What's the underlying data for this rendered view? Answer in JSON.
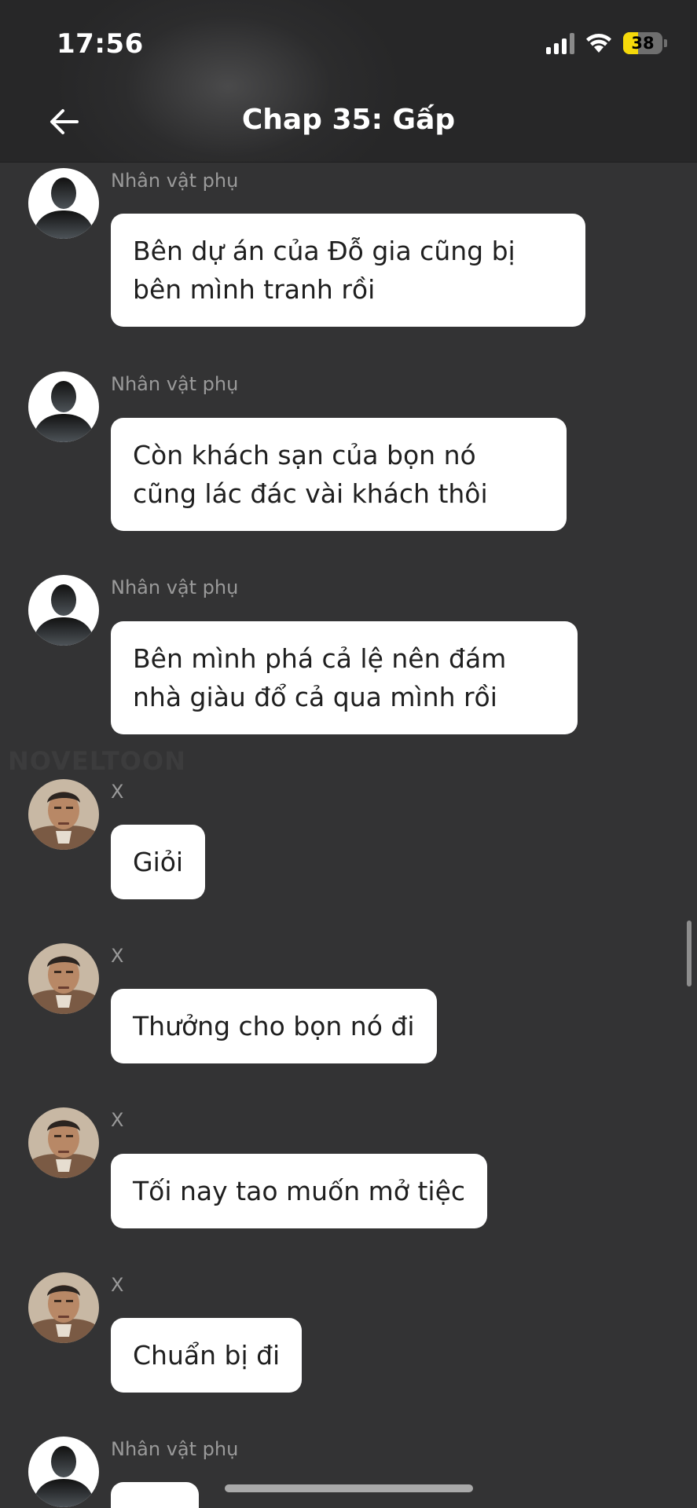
{
  "status_bar": {
    "time": "17:56",
    "battery": "38",
    "battery_level": 0.38
  },
  "header": {
    "back_icon": "arrow-left-icon",
    "title": "Chap 35: Gấp"
  },
  "watermark": "NOVELTOON",
  "messages": [
    {
      "sender": "Nhân vật phụ",
      "avatar": "silhouette-avatar",
      "text": "Bên dự án của Đỗ gia cũng bị bên mình tranh rồi"
    },
    {
      "sender": "Nhân vật phụ",
      "avatar": "silhouette-avatar",
      "text": "Còn khách sạn của bọn nó cũng lác đác vài khách thôi"
    },
    {
      "sender": "Nhân vật phụ",
      "avatar": "silhouette-avatar",
      "text": "Bên mình phá cả lệ nên đám nhà giàu đổ cả qua mình rồi"
    },
    {
      "sender": "X",
      "avatar": "character-x-avatar",
      "text": "Giỏi"
    },
    {
      "sender": "X",
      "avatar": "character-x-avatar",
      "text": "Thưởng cho bọn nó đi"
    },
    {
      "sender": "X",
      "avatar": "character-x-avatar",
      "text": "Tối nay tao muốn mở tiệc"
    },
    {
      "sender": "X",
      "avatar": "character-x-avatar",
      "text": "Chuẩn bị đi"
    },
    {
      "sender": "Nhân vật phụ",
      "avatar": "silhouette-avatar",
      "text": ""
    }
  ]
}
